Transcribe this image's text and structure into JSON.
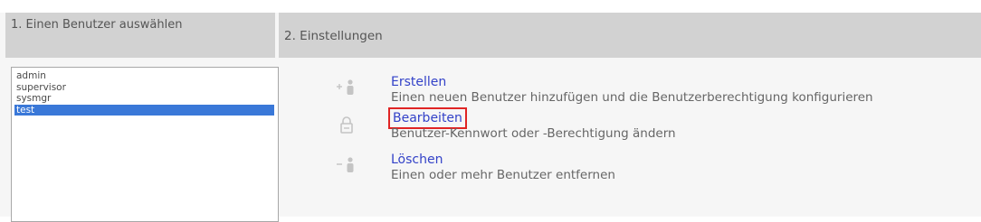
{
  "users_panel": {
    "heading": "1. Einen Benutzer auswählen",
    "users": [
      {
        "name": "admin",
        "selected": false
      },
      {
        "name": "supervisor",
        "selected": false
      },
      {
        "name": "sysmgr",
        "selected": false
      },
      {
        "name": "test",
        "selected": true
      }
    ]
  },
  "settings_panel": {
    "heading": "2. Einstellungen",
    "actions": [
      {
        "label": "Erstellen",
        "description": "Einen neuen Benutzer hinzufügen und die Benutzerberechtigung konfigurieren",
        "icon": "add-user-icon"
      },
      {
        "label": "Bearbeiten",
        "description": "Benutzer-Kennwort oder -Berechtigung ändern",
        "icon": "lock-icon"
      },
      {
        "label": "Löschen",
        "description": "Einen oder mehr Benutzer entfernen",
        "icon": "remove-user-icon"
      }
    ]
  },
  "colors": {
    "header_bg": "#d2d2d2",
    "link": "#3342c8",
    "selection": "#3a78d8",
    "highlight_border": "#e02424"
  }
}
